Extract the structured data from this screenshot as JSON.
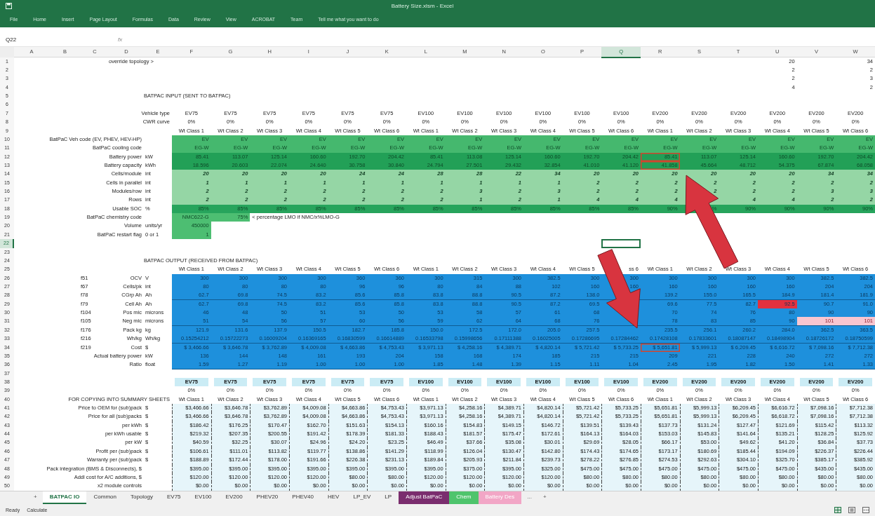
{
  "window": {
    "title": "Battery Size.xlsm - Excel"
  },
  "ribbon_tabs": [
    "File",
    "Home",
    "Insert",
    "Page Layout",
    "Formulas",
    "Data",
    "Review",
    "View",
    "ACROBAT",
    "Team",
    "Tell me what you want to do"
  ],
  "formula_bar": {
    "name_box": "Q22",
    "function_label": "fx"
  },
  "columns": [
    {
      "letter": "A",
      "selected": false
    },
    {
      "letter": "B",
      "selected": false
    },
    {
      "letter": "C",
      "selected": false
    },
    {
      "letter": "D",
      "selected": false
    },
    {
      "letter": "E",
      "selected": false
    },
    {
      "letter": "F",
      "selected": false
    },
    {
      "letter": "G",
      "selected": false
    },
    {
      "letter": "H",
      "selected": false
    },
    {
      "letter": "I",
      "selected": false
    },
    {
      "letter": "J",
      "selected": false
    },
    {
      "letter": "K",
      "selected": false
    },
    {
      "letter": "L",
      "selected": false
    },
    {
      "letter": "M",
      "selected": false
    },
    {
      "letter": "N",
      "selected": false
    },
    {
      "letter": "O",
      "selected": false
    },
    {
      "letter": "P",
      "selected": false
    },
    {
      "letter": "Q",
      "selected": true
    },
    {
      "letter": "R",
      "selected": false
    },
    {
      "letter": "S",
      "selected": false
    },
    {
      "letter": "T",
      "selected": false
    },
    {
      "letter": "U",
      "selected": false
    },
    {
      "letter": "V",
      "selected": false
    },
    {
      "letter": "W",
      "selected": false
    }
  ],
  "rows": [
    {
      "number": "1",
      "selected": false,
      "pointer": "override topology >",
      "cells": [
        null,
        null,
        null,
        null,
        null,
        null,
        null,
        null,
        null,
        null,
        null,
        null,
        null,
        null,
        null,
        "20",
        null,
        "34"
      ]
    },
    {
      "number": "2",
      "selected": false,
      "cells": [
        null,
        null,
        null,
        null,
        null,
        null,
        null,
        null,
        null,
        null,
        null,
        null,
        null,
        null,
        null,
        "2",
        null,
        "2"
      ]
    },
    {
      "number": "3",
      "selected": false,
      "cells": [
        null,
        null,
        null,
        null,
        null,
        null,
        null,
        null,
        null,
        null,
        null,
        null,
        null,
        null,
        null,
        "2",
        null,
        "3"
      ]
    },
    {
      "number": "4",
      "selected": false,
      "cells": [
        null,
        null,
        null,
        null,
        null,
        null,
        null,
        null,
        null,
        null,
        null,
        null,
        null,
        null,
        null,
        "4",
        null,
        "2"
      ]
    },
    {
      "number": "5",
      "selected": false,
      "heading": "BATPAC INPUT (SENT TO BATPAC)"
    },
    {
      "number": "6",
      "selected": false
    },
    {
      "number": "7",
      "selected": false,
      "kind": "header",
      "label": "Vehicle type",
      "cells": [
        "EV75",
        "EV75",
        "EV75",
        "EV75",
        "EV75",
        "EV75",
        "EV100",
        "EV100",
        "EV100",
        "EV100",
        "EV100",
        "EV100",
        "EV200",
        "EV200",
        "EV200",
        "EV200",
        "EV200",
        "EV200"
      ]
    },
    {
      "number": "8",
      "selected": false,
      "kind": "header",
      "label": "CWR curve",
      "cells": [
        "0%",
        "0%",
        "0%",
        "0%",
        "0%",
        "0%",
        "0%",
        "0%",
        "0%",
        "0%",
        "0%",
        "0%",
        "0%",
        "0%",
        "0%",
        "0%",
        "0%",
        "0%"
      ]
    },
    {
      "number": "9",
      "selected": false,
      "kind": "header",
      "cells": [
        "Wt Class 1",
        "Wt Class 2",
        "Wt Class 3",
        "Wt Class 4",
        "Wt Class 5",
        "Wt Class 6",
        "Wt Class 1",
        "Wt Class 2",
        "Wt Class 3",
        "Wt Class 4",
        "Wt Class 5",
        "Wt Class 6",
        "Wt Class 1",
        "Wt Class 2",
        "Wt Class 3",
        "Wt Class 4",
        "Wt Class 5",
        "Wt Class 6"
      ]
    },
    {
      "number": "10",
      "selected": false,
      "kind": "vcode",
      "label": "BatPaC Veh code (EV, PHEV, HEV-HP)",
      "cells": [
        "EV",
        "EV",
        "EV",
        "EV",
        "EV",
        "EV",
        "EV",
        "EV",
        "EV",
        "EV",
        "EV",
        "EV",
        "EV",
        "EV",
        "EV",
        "EV",
        "EV",
        "EV"
      ]
    },
    {
      "number": "11",
      "selected": false,
      "kind": "vcode",
      "label": "BatPaC cooling code",
      "cells": [
        "EG-W",
        "EG-W",
        "EG-W",
        "EG-W",
        "EG-W",
        "EG-W",
        "EG-W",
        "EG-W",
        "EG-W",
        "EG-W",
        "EG-W",
        "EG-W",
        "EG-W",
        "EG-W",
        "EG-W",
        "EG-W",
        "EG-W",
        "EG-W"
      ]
    },
    {
      "number": "12",
      "selected": false,
      "kind": "power",
      "label": "Battery power",
      "unit": "kW",
      "cells": [
        "85.41",
        "113.07",
        "125.14",
        "160.60",
        "192.70",
        "204.42",
        "85.41",
        "113.08",
        "125.14",
        "160.60",
        "192.70",
        "204.42",
        {
          "text": "85.41",
          "kind": "boxed"
        },
        "113.07",
        "125.14",
        "160.60",
        "192.70",
        "204.42"
      ]
    },
    {
      "number": "13",
      "selected": false,
      "kind": "power",
      "label": "Battery capacity",
      "unit": "kWh",
      "cells": [
        "18.596",
        "20.603",
        "22.074",
        "24.640",
        "30.758",
        "30.840",
        "24.794",
        "27.501",
        "29.432",
        "32.854",
        "41.010",
        "41.120",
        {
          "text": "41.858",
          "kind": "boxed"
        },
        "45.664",
        "48.712",
        "54.375",
        "67.874",
        "68.058"
      ]
    },
    {
      "number": "14",
      "selected": false,
      "kind": "layout",
      "label": "Cells/module",
      "unit": "int",
      "cells": [
        "20",
        "20",
        "20",
        "20",
        "24",
        "24",
        "28",
        "28",
        "22",
        "34",
        "20",
        "20",
        "20",
        "20",
        "20",
        "20",
        "34",
        "34"
      ]
    },
    {
      "number": "15",
      "selected": false,
      "kind": "layout",
      "label": "Cells in parallel",
      "unit": "int",
      "cells": [
        "1",
        "1",
        "1",
        "1",
        "1",
        "1",
        "1",
        "1",
        "1",
        "1",
        "2",
        "2",
        "2",
        "2",
        "2",
        "2",
        "2",
        "2"
      ]
    },
    {
      "number": "16",
      "selected": false,
      "kind": "layout",
      "label": "Modules/row",
      "unit": "int",
      "cells": [
        "2",
        "2",
        "2",
        "2",
        "2",
        "2",
        "2",
        "3",
        "2",
        "3",
        "2",
        "2",
        "2",
        "2",
        "2",
        "2",
        "3",
        "3"
      ]
    },
    {
      "number": "17",
      "selected": false,
      "kind": "layout",
      "label": "Rows",
      "unit": "int",
      "cells": [
        "2",
        "2",
        "2",
        "2",
        "2",
        "2",
        "2",
        "1",
        "2",
        "1",
        "4",
        "4",
        "4",
        {
          "kind": "covered"
        },
        "4",
        "4",
        "2",
        "2"
      ]
    },
    {
      "number": "18",
      "selected": false,
      "kind": "soc",
      "label": "Usable SOC",
      "unit": "%",
      "cells": [
        "85%",
        "85%",
        "85%",
        "85%",
        "85%",
        "85%",
        "85%",
        "85%",
        "85%",
        "85%",
        "85%",
        "85%",
        "90%",
        "%",
        "90%",
        "90%",
        "90%",
        "90%"
      ]
    },
    {
      "number": "19",
      "selected": false,
      "kind": "setting",
      "label": "BatPaC chemistry code",
      "note": "< percentage LMO if NMC/x%LMO-G",
      "cells": [
        "NMC622-G",
        "75%"
      ]
    },
    {
      "number": "20",
      "selected": false,
      "kind": "setting",
      "label": "Volume",
      "unit": "units/yr",
      "cells": [
        "450000"
      ]
    },
    {
      "number": "21",
      "selected": false,
      "kind": "setting",
      "label": "BatPaC restart flag",
      "unit": "0 or 1",
      "cells": [
        "1"
      ]
    },
    {
      "number": "22",
      "selected": true
    },
    {
      "number": "23",
      "selected": false
    },
    {
      "number": "24",
      "selected": false,
      "heading": "BATPAC OUTPUT (RECEIVED FROM BATPAC)"
    },
    {
      "number": "25",
      "selected": false,
      "kind": "header",
      "cells": [
        "Wt Class 1",
        "Wt Class 2",
        "Wt Class 3",
        "Wt Class 4",
        "Wt Class 5",
        "Wt Class 6",
        "Wt Class 1",
        "Wt Class 2",
        "Wt Class 3",
        "Wt Class 4",
        "Wt Class 5",
        {
          "text": "ss 6",
          "kind": "cut"
        },
        "Wt Class 1",
        "Wt Class 2",
        "Wt Class 3",
        "Wt Class 4",
        "Wt Class 5",
        "Wt Class 6"
      ]
    },
    {
      "number": "26",
      "selected": false,
      "kind": "output",
      "code": "f51",
      "label": "OCV",
      "unit": "V",
      "cells": [
        "300",
        "300",
        "300",
        "300",
        "360",
        "360",
        "300",
        "315",
        "300",
        "382.5",
        "300",
        "300",
        "300",
        "300",
        "300",
        "300",
        "382.5",
        "382.5"
      ]
    },
    {
      "number": "27",
      "selected": false,
      "kind": "output",
      "code": "f67",
      "label": "Cells/pk",
      "unit": "int",
      "cells": [
        "80",
        "80",
        "80",
        "80",
        "96",
        "96",
        "80",
        "84",
        "88",
        "102",
        "160",
        "160",
        "160",
        "160",
        "160",
        "160",
        "204",
        "204"
      ]
    },
    {
      "number": "28",
      "selected": false,
      "kind": "output",
      "code": "f78",
      "label": "CGrp Ah",
      "unit": "Ah",
      "cells": [
        "62.7",
        "69.8",
        "74.5",
        "83.2",
        "85.6",
        "85.8",
        "83.8",
        "88.8",
        "90.5",
        "87.2",
        "138.0",
        {
          "kind": "covered"
        },
        "139.2",
        "155.0",
        "165.5",
        "184.9",
        "181.4",
        "181.9"
      ]
    },
    {
      "number": "29",
      "selected": false,
      "kind": "output",
      "code": "f79",
      "label": "Cell Ah",
      "unit": "Ah",
      "cells": [
        "62.7",
        "69.8",
        "74.5",
        "83.2",
        "85.6",
        "85.8",
        "83.8",
        "88.8",
        "90.5",
        "87.2",
        "69.5",
        {
          "kind": "covered"
        },
        "69.6",
        "77.5",
        "82.7",
        {
          "text": "92.5",
          "kind": "alert"
        },
        "90.7",
        "91.0"
      ]
    },
    {
      "number": "30",
      "selected": false,
      "kind": "output",
      "code": "f104",
      "label": "Pos mic",
      "unit": "microns",
      "cells": [
        "46",
        "48",
        "50",
        "51",
        "53",
        "50",
        "53",
        "58",
        "57",
        "61",
        "68",
        {
          "kind": "covered"
        },
        "70",
        "74",
        "76",
        "80",
        "90",
        "90"
      ]
    },
    {
      "number": "31",
      "selected": false,
      "kind": "output",
      "code": "f105",
      "label": "Neg mic",
      "unit": "microns",
      "cells": [
        "51",
        "54",
        "56",
        "57",
        "60",
        "56",
        "59",
        "62",
        "64",
        "68",
        "76",
        {
          "kind": "covered"
        },
        "78",
        "83",
        "85",
        "90",
        {
          "text": "101",
          "kind": "warn"
        },
        {
          "text": "101",
          "kind": "warn"
        }
      ]
    },
    {
      "number": "32",
      "selected": false,
      "kind": "output",
      "code": "f176",
      "label": "Pack kg",
      "unit": "kg",
      "cells": [
        "121.9",
        "131.6",
        "137.9",
        "150.5",
        "182.7",
        "185.8",
        "150.0",
        "172.5",
        "172.0",
        "205.0",
        "257.5",
        {
          "kind": "covered"
        },
        "235.5",
        "256.1",
        "260.2",
        "284.0",
        "362.5",
        "363.5"
      ]
    },
    {
      "number": "33",
      "selected": false,
      "kind": "output",
      "code": "f216",
      "label": "Wh/kg",
      "unit": "Wh/kg",
      "cells": [
        "0.15254212",
        "0.15722273",
        "0.16009204",
        "0.16369165",
        "0.16830599",
        "0.16614889",
        "0.16533798",
        "0.15998656",
        "0.17111388",
        "0.16025005",
        "0.17286695",
        "0.17284462",
        "0.17428108",
        "0.17833601",
        "0.18087147",
        "0.18498904",
        "0.18726172",
        "0.18750599"
      ]
    },
    {
      "number": "34",
      "selected": false,
      "kind": "output",
      "code": "f219",
      "label": "Cost",
      "unit": "$",
      "cells": [
        "$ 3,466.66",
        "$ 3,646.78",
        "$ 3,762.89",
        "$ 4,009.08",
        "$ 4,663.86",
        "$ 4,753.43",
        "$ 3,971.13",
        "$ 4,258.16",
        "$ 4,389.71",
        "$ 4,820.14",
        "$ 5,721.42",
        "$ 5,733.25",
        {
          "text": "$ 5,651.81",
          "kind": "boxed"
        },
        "$ 5,999.13",
        "$ 6,209.45",
        "$ 6,616.72",
        "$ 7,098.16",
        "$ 7,712.38"
      ]
    },
    {
      "number": "35",
      "selected": false,
      "kind": "output",
      "label": "Actual battery power",
      "unit": "kW",
      "cells": [
        "136",
        "144",
        "148",
        "161",
        "193",
        "204",
        "158",
        "168",
        "174",
        "185",
        "215",
        "215",
        "209",
        "221",
        "228",
        "240",
        "272",
        "272"
      ]
    },
    {
      "number": "36",
      "selected": false,
      "kind": "output",
      "label": "Ratio",
      "unit": "float",
      "cells": [
        "1.59",
        "1.27",
        "1.19",
        "1.00",
        "1.00",
        "1.00",
        "1.85",
        "1.48",
        "1.39",
        "1.15",
        "1.11",
        "1.04",
        "2.45",
        "1.95",
        "1.82",
        "1.50",
        "1.41",
        "1.33"
      ]
    },
    {
      "number": "37",
      "selected": false
    },
    {
      "number": "38",
      "selected": false,
      "kind": "tag",
      "cells": [
        "EV75",
        "EV75",
        "EV75",
        "EV75",
        "EV75",
        "EV75",
        "EV100",
        "EV100",
        "EV100",
        "EV100",
        "EV100",
        "EV100",
        "EV200",
        "EV200",
        "EV200",
        "EV200",
        "EV200",
        "EV200"
      ]
    },
    {
      "number": "39",
      "selected": false,
      "kind": "header",
      "cells": [
        "0%",
        "0%",
        "0%",
        "0%",
        "0%",
        "0%",
        "0%",
        "0%",
        "0%",
        "0%",
        "0%",
        "0%",
        "0%",
        "0%",
        "0%",
        "0%",
        "0%",
        "0%"
      ]
    },
    {
      "number": "40",
      "selected": false,
      "kind": "header",
      "label": "FOR COPYING INTO SUMMARY SHEETS",
      "cells": [
        "Wt Class 1",
        "Wt Class 2",
        "Wt Class 3",
        "Wt Class 4",
        "Wt Class 5",
        "Wt Class 6",
        "Wt Class 1",
        "Wt Class 2",
        "Wt Class 3",
        "Wt Class 4",
        "Wt Class 5",
        "Wt Class 6",
        "Wt Class 1",
        "Wt Class 2",
        "Wt Class 3",
        "Wt Class 4",
        "Wt Class 5",
        "Wt Class 6"
      ]
    },
    {
      "number": "41",
      "selected": false,
      "kind": "copy",
      "label": "Price to OEM for (sub)pack",
      "unit": "$",
      "cells": [
        "$3,466.66",
        "$3,646.78",
        "$3,762.89",
        "$4,009.08",
        "$4,663.86",
        "$4,753.43",
        "$3,971.13",
        "$4,258.16",
        "$4,389.71",
        "$4,820.14",
        "$5,721.42",
        "$5,733.25",
        "$5,651.81",
        "$5,999.13",
        "$6,209.45",
        "$6,616.72",
        "$7,098.16",
        "$7,712.38"
      ]
    },
    {
      "number": "42",
      "selected": false,
      "kind": "copy",
      "label": "Price for all (sub)packs",
      "unit": "$",
      "cells": [
        "$3,466.66",
        "$3,646.78",
        "$3,762.89",
        "$4,009.08",
        "$4,663.86",
        "$4,753.43",
        "$3,971.13",
        "$4,258.16",
        "$4,389.71",
        "$4,820.14",
        "$5,721.42",
        "$5,733.25",
        "$5,651.81",
        "$5,999.13",
        "$6,209.45",
        "$6,618.72",
        "$7,098.16",
        "$7,712.38"
      ]
    },
    {
      "number": "43",
      "selected": false,
      "kind": "copy",
      "label": "per kWh",
      "unit": "$",
      "cells": [
        "$186.42",
        "$176.25",
        "$170.47",
        "$162.70",
        "$151.63",
        "$154.13",
        "$160.16",
        "$154.83",
        "$149.15",
        "$146.72",
        "$139.51",
        "$139.43",
        "$137.73",
        "$131.24",
        "$127.47",
        "$121.69",
        "$115.42",
        "$113.32"
      ]
    },
    {
      "number": "44",
      "selected": false,
      "kind": "copy",
      "label": "per kWh usable",
      "unit": "$",
      "cells": [
        "$219.32",
        "$207.35",
        "$200.55",
        "$191.42",
        "$178.39",
        "$181.33",
        "$188.43",
        "$181.57",
        "$175.47",
        "$172.61",
        "$164.13",
        "$164.03",
        "$153.03",
        "$145.83",
        "$141.64",
        "$135.21",
        "$128.25",
        "$125.92"
      ]
    },
    {
      "number": "45",
      "selected": false,
      "kind": "copy",
      "label": "per kW",
      "unit": "$",
      "cells": [
        "$40.59",
        "$32.25",
        "$30.07",
        "$24.96",
        "$24.20",
        "$23.25",
        "$46.49",
        "$37.66",
        "$35.08",
        "$30.01",
        "$29.69",
        "$28.05",
        "$66.17",
        "$53.00",
        "$49.62",
        "$41.20",
        "$36.84",
        "$37.73"
      ]
    },
    {
      "number": "46",
      "selected": false,
      "kind": "copy",
      "label": "Profit per (sub)pack",
      "unit": "$",
      "cells": [
        "$106.61",
        "$111.01",
        "$113.82",
        "$119.77",
        "$138.86",
        "$141.29",
        "$118.99",
        "$126.04",
        "$130.47",
        "$142.80",
        "$174.43",
        "$174.65",
        "$173.17",
        "$180.69",
        "$185.44",
        "$194.09",
        "$226.37",
        "$226.44"
      ]
    },
    {
      "number": "47",
      "selected": false,
      "kind": "copy",
      "label": "Warranty per (sub)pack",
      "unit": "$",
      "cells": [
        "$188.89",
        "$172.44",
        "$178.00",
        "$191.66",
        "$226.38",
        "$231.13",
        "$189.84",
        "$205.93",
        "$211.84",
        "$239.73",
        "$278.22",
        "$276.85",
        "$274.53",
        "$292.63",
        "$304.10",
        "$325.70",
        "$385.17",
        "$385.92"
      ]
    },
    {
      "number": "48",
      "selected": false,
      "kind": "copy",
      "label": "Pack integration (BMS & Disconnects), $",
      "cells": [
        "$395.00",
        "$395.00",
        "$395.00",
        "$395.00",
        "$395.00",
        "$395.00",
        "$395.00",
        "$375.00",
        "$395.00",
        "$325.00",
        "$475.00",
        "$475.00",
        "$475.00",
        "$475.00",
        "$475.00",
        "$475.00",
        "$435.00",
        "$435.00"
      ]
    },
    {
      "number": "49",
      "selected": false,
      "kind": "copy",
      "label": "Addl cost for A/C additions, $",
      "cells": [
        "$120.00",
        "$120.00",
        "$120.00",
        "$120.00",
        "$80.00",
        "$80.00",
        "$120.00",
        "$120.00",
        "$120.00",
        "$120.00",
        "$80.00",
        "$80.00",
        "$80.00",
        "$80.00",
        "$80.00",
        "$80.00",
        "$80.00",
        "$80.00"
      ]
    },
    {
      "number": "50",
      "selected": false,
      "kind": "copy",
      "label": "x2 module controls",
      "cells": [
        "$0.00",
        "$0.00",
        "$0.00",
        "$0.00",
        "$0.00",
        "$0.00",
        "$0.00",
        "$0.00",
        "$0.00",
        "$0.00",
        "$0.00",
        "$0.00",
        "$0.00",
        "$0.00",
        "$0.00",
        "$0.00",
        "$0.00",
        "$0.00"
      ]
    }
  ],
  "sheet_tabs": {
    "lead": "+",
    "tabs": [
      {
        "label": "BATPAC IO",
        "selected": true
      },
      {
        "label": "Common",
        "selected": false
      },
      {
        "label": "Topology",
        "selected": false
      },
      {
        "label": "EV75",
        "selected": false
      },
      {
        "label": "EV100",
        "selected": false
      },
      {
        "label": "EV200",
        "selected": false
      },
      {
        "label": "PHEV20",
        "selected": false
      },
      {
        "label": "PHEV40",
        "selected": false
      },
      {
        "label": "HEV",
        "selected": false
      },
      {
        "label": "LP_EV",
        "selected": false
      },
      {
        "label": "LP",
        "selected": false
      },
      {
        "label": "Adjust BatPaC",
        "selected": false,
        "color": "#7a2d6e"
      },
      {
        "label": "Chem",
        "selected": false,
        "color": "#4fc46c"
      },
      {
        "label": "Battery Des",
        "selected": false,
        "color": "#f2a6c6"
      }
    ],
    "more": "...",
    "add": "+"
  },
  "status_bar": {
    "items": [
      "Ready",
      "Calculate"
    ]
  }
}
